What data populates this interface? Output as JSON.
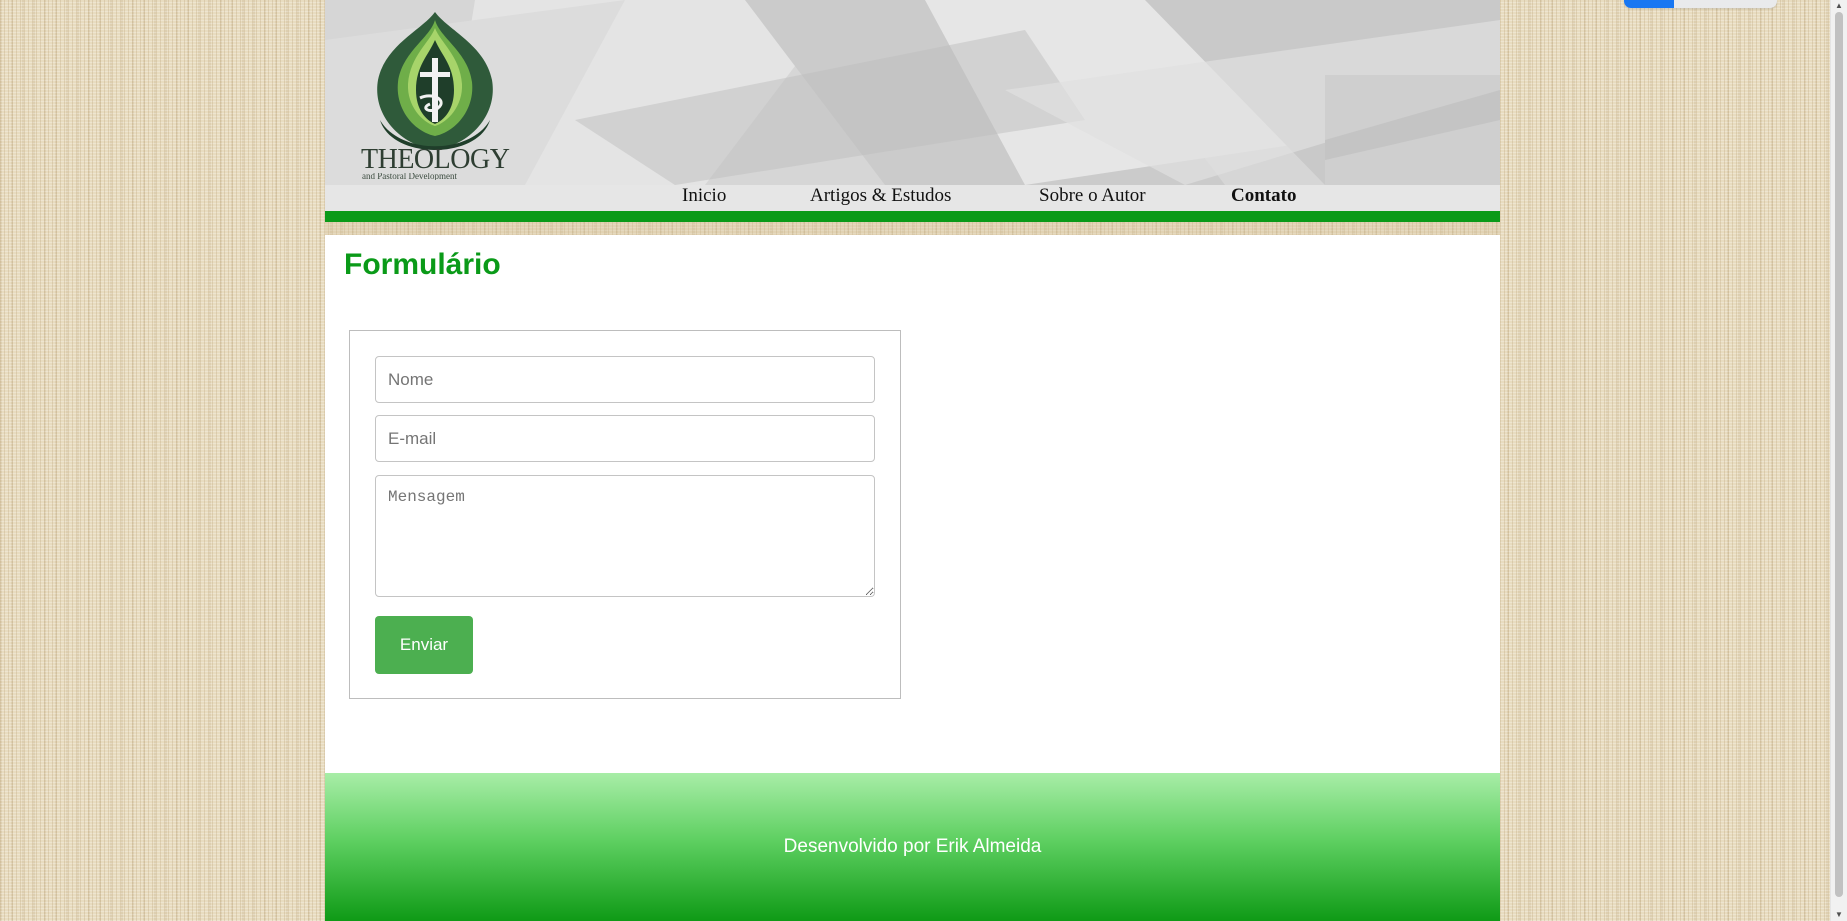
{
  "site": {
    "logo_text": "THEOLOGY",
    "logo_tagline": "and Pastoral Development"
  },
  "nav": {
    "items": [
      {
        "label": "Inicio"
      },
      {
        "label": "Artigos & Estudos"
      },
      {
        "label": "Sobre o Autor"
      },
      {
        "label": "Contato",
        "active": true
      }
    ]
  },
  "main": {
    "title": "Formulário",
    "form": {
      "name_placeholder": "Nome",
      "email_placeholder": "E-mail",
      "message_placeholder": "Mensagem",
      "submit_label": "Enviar"
    }
  },
  "footer": {
    "text": "Desenvolvido por Erik Almeida"
  },
  "colors": {
    "accent_green": "#0a9a18",
    "button_green": "#4caf50",
    "footer_gradient_top": "#a8eda7",
    "footer_gradient_bottom": "#0f9a16"
  },
  "icons": {
    "logo": "flame-cross-logo-icon"
  }
}
